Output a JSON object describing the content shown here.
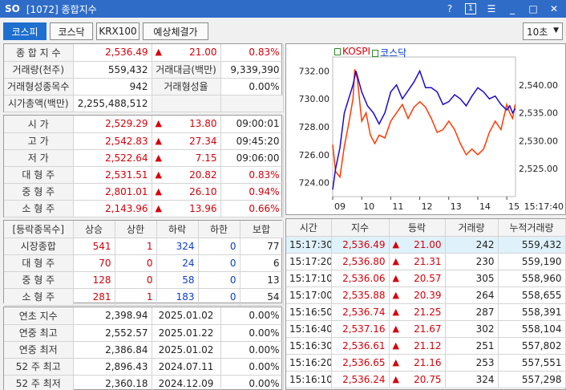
{
  "window": {
    "logo": "SO",
    "title": "[1072] 종합지수",
    "help": "?",
    "num": "1"
  },
  "tabs": [
    {
      "label": "코스피"
    },
    {
      "label": "코스닥"
    },
    {
      "label": "KRX100"
    },
    {
      "label": "예상체결가"
    }
  ],
  "interval": "10초",
  "summary": {
    "index_label": "종 합 지 수",
    "index_value": "2,536.49",
    "index_change": "21.00",
    "index_rate": "0.83%",
    "vol_label": "거래량(천주)",
    "vol_value": "559,432",
    "amt_label": "거래대금(백만)",
    "amt_value": "9,339,390",
    "form_cnt_label": "거래형성종목수",
    "form_cnt_value": "942",
    "form_rate_label": "거래형성율",
    "form_rate_value": "0.00%",
    "mcap_label": "시가총액(백만)",
    "mcap_value": "2,255,488,512"
  },
  "ohlc": [
    {
      "label": "시   가",
      "value": "2,529.29",
      "change": "13.80",
      "extra": "09:00:01"
    },
    {
      "label": "고   가",
      "value": "2,542.83",
      "change": "27.34",
      "extra": "09:45:20"
    },
    {
      "label": "저   가",
      "value": "2,522.64",
      "change": "7.15",
      "extra": "09:06:00"
    },
    {
      "label": "대 형 주",
      "value": "2,531.51",
      "change": "20.82",
      "extra": "0.83%"
    },
    {
      "label": "중 형 주",
      "value": "2,801.01",
      "change": "26.10",
      "extra": "0.94%"
    },
    {
      "label": "소 형 주",
      "value": "2,143.96",
      "change": "13.96",
      "extra": "0.66%"
    }
  ],
  "breadth": {
    "headers": [
      "[등락종목수]",
      "상승",
      "상한",
      "하락",
      "하한",
      "보합"
    ],
    "rows": [
      [
        "시장종합",
        "541",
        "1",
        "324",
        "0",
        "77"
      ],
      [
        "대 형 주",
        "70",
        "0",
        "24",
        "0",
        "6"
      ],
      [
        "중 형 주",
        "128",
        "0",
        "58",
        "0",
        "13"
      ],
      [
        "소 형 주",
        "281",
        "1",
        "183",
        "0",
        "54"
      ]
    ]
  },
  "extremes": [
    [
      "연초  지수",
      "2,398.94",
      "2025.01.02",
      "0.00%"
    ],
    [
      "연중  최고",
      "2,552.57",
      "2025.01.22",
      "0.00%"
    ],
    [
      "연중  최저",
      "2,386.84",
      "2025.01.02",
      "0.00%"
    ],
    [
      "52 주 최고",
      "2,896.43",
      "2024.07.11",
      "0.00%"
    ],
    [
      "52 주 최저",
      "2,360.18",
      "2024.12.09",
      "0.00%"
    ]
  ],
  "ticks": {
    "headers": [
      "시간",
      "지수",
      "등락",
      "거래량",
      "누적거래량"
    ],
    "rows": [
      [
        "15:17:30",
        "2,536.49",
        "21.00",
        "242",
        "559,432"
      ],
      [
        "15:17:20",
        "2,536.80",
        "21.31",
        "230",
        "559,190"
      ],
      [
        "15:17:10",
        "2,536.06",
        "20.57",
        "305",
        "558,960"
      ],
      [
        "15:17:00",
        "2,535.88",
        "20.39",
        "264",
        "558,655"
      ],
      [
        "15:16:50",
        "2,536.74",
        "21.25",
        "287",
        "558,391"
      ],
      [
        "15:16:40",
        "2,537.16",
        "21.67",
        "302",
        "558,104"
      ],
      [
        "15:16:30",
        "2,536.61",
        "21.12",
        "251",
        "557,802"
      ],
      [
        "15:16:20",
        "2,536.65",
        "21.16",
        "253",
        "557,551"
      ],
      [
        "15:16:10",
        "2,536.24",
        "20.75",
        "324",
        "557,298"
      ]
    ]
  },
  "colors": {
    "accent": "#2f6cc8",
    "up": "#d6000a",
    "down": "#0a3fd0",
    "kospi_line": "#ff3a00",
    "kosdaq_line": "#1a0ad0"
  },
  "icons": {
    "triangle_up": "▲",
    "help": "?",
    "menu": "☰",
    "minimize": "_",
    "maximize": "□",
    "close": "✕"
  },
  "chart_data": {
    "type": "line",
    "legend": [
      "KOSPI",
      "코스닥"
    ],
    "x_ticks": [
      "09",
      "10",
      "11",
      "12",
      "13",
      "14",
      "15",
      "15:17:40"
    ],
    "left_ticks": [
      "732.00",
      "730.00",
      "728.00",
      "726.00",
      "724.00"
    ],
    "right_ticks": [
      "2,540.00",
      "2,535.00",
      "2,530.00",
      "2,525.00"
    ],
    "left_range": [
      723,
      733
    ],
    "right_range": [
      2520,
      2545
    ],
    "x_range": [
      9.0,
      15.3
    ],
    "series": [
      {
        "name": "KOSPI",
        "axis": "right",
        "x": [
          9.0,
          9.1,
          9.25,
          9.4,
          9.55,
          9.7,
          9.76,
          9.85,
          10.0,
          10.15,
          10.3,
          10.45,
          10.6,
          10.8,
          11.0,
          11.2,
          11.4,
          11.6,
          11.8,
          12.0,
          12.2,
          12.4,
          12.6,
          12.8,
          13.0,
          13.2,
          13.4,
          13.6,
          13.8,
          14.0,
          14.2,
          14.4,
          14.6,
          14.8,
          15.0,
          15.1,
          15.2,
          15.29
        ],
        "y": [
          2529.3,
          2524.5,
          2523.5,
          2529.0,
          2533.0,
          2537.5,
          2542.8,
          2541.0,
          2533.5,
          2535.0,
          2531.0,
          2529.5,
          2531.0,
          2530.5,
          2533.5,
          2535.0,
          2536.5,
          2534.0,
          2536.0,
          2537.0,
          2536.0,
          2534.0,
          2531.5,
          2532.0,
          2533.5,
          2532.0,
          2529.5,
          2527.5,
          2528.5,
          2527.5,
          2528.5,
          2531.5,
          2533.5,
          2532.0,
          2536.5,
          2535.0,
          2534.0,
          2536.5
        ]
      },
      {
        "name": "코스닥",
        "axis": "left",
        "x": [
          9.0,
          9.1,
          9.25,
          9.4,
          9.55,
          9.7,
          9.8,
          10.0,
          10.2,
          10.4,
          10.6,
          10.8,
          11.0,
          11.2,
          11.4,
          11.6,
          11.8,
          12.0,
          12.2,
          12.4,
          12.6,
          12.8,
          13.0,
          13.2,
          13.4,
          13.6,
          13.8,
          14.0,
          14.2,
          14.4,
          14.6,
          14.8,
          15.0,
          15.1,
          15.2,
          15.29
        ],
        "y": [
          723.5,
          725.0,
          726.5,
          729.0,
          730.0,
          731.0,
          732.0,
          730.5,
          729.5,
          729.0,
          728.2,
          729.0,
          730.5,
          731.0,
          730.0,
          730.6,
          731.2,
          732.0,
          730.8,
          730.8,
          730.5,
          729.6,
          729.8,
          730.3,
          730.0,
          729.5,
          730.2,
          730.8,
          730.5,
          730.0,
          730.2,
          729.6,
          729.2,
          729.5,
          729.0,
          729.3
        ]
      }
    ]
  }
}
